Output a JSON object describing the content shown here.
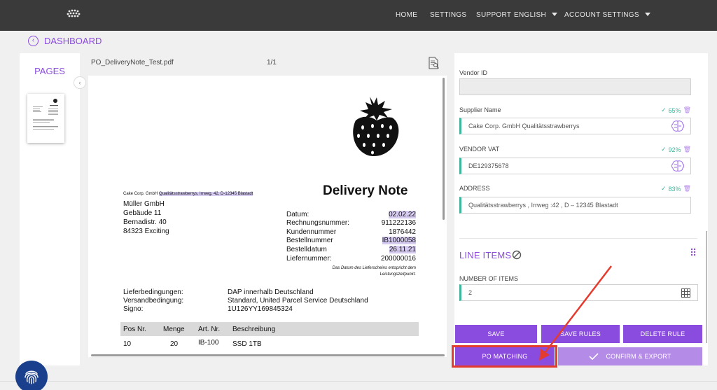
{
  "nav": {
    "home": "HOME",
    "settings": "SETTINGS",
    "support": "SUPPORT",
    "language": "ENGLISH",
    "account": "ACCOUNT SETTINGS"
  },
  "breadcrumb": {
    "label": "DASHBOARD"
  },
  "pages": {
    "title": "PAGES"
  },
  "viewer": {
    "filename": "PO_DeliveryNote_Test.pdf",
    "page_indicator": "1/1"
  },
  "document": {
    "sender_prefix": "Cake Corp. GmbH",
    "sender_rest": "Qualitätsstrawberrys, Irrweg. 42, D-12345 Blastadt",
    "title": "Delivery Note",
    "recipient": [
      "Müller GmbH",
      "Gebäude 11",
      "Bernadistr. 40",
      "84323 Exciting"
    ],
    "meta_labels": [
      "Datum:",
      "Rechnungsnummer:",
      "Kundennummer",
      "Bestellnummer",
      "Bestelldatum",
      "Liefernummer:"
    ],
    "meta_values": [
      "02.02.22",
      "911222136",
      "1876442",
      "IB1000058",
      "26.11.21",
      "200000016"
    ],
    "footnote_line1": "Das Datum des Lieferscheins entspricht dem",
    "footnote_line2": "Leistungszeitpunkt.",
    "terms_labels": [
      "Lieferbedingungen:",
      "Versandbedingung:",
      "Signo:"
    ],
    "terms_values": [
      "DAP innerhalb Deutschland",
      "Standard, United Parcel Service Deutschland",
      "1U126YY169845324"
    ],
    "table_headers": [
      "Pos Nr.",
      "Menge",
      "Art. Nr.",
      "Beschreibung"
    ],
    "table_row": [
      "10",
      "20",
      "IB-100",
      "SSD 1TB"
    ]
  },
  "form": {
    "vendor_id_label": "Vendor ID",
    "vendor_id_value": "",
    "supplier_label": "Supplier Name",
    "supplier_conf": "65%",
    "supplier_value": "Cake Corp. GmbH Qualitätsstrawberrys",
    "vat_label": "VENDOR VAT",
    "vat_conf": "92%",
    "vat_value": "DE129375678",
    "address_label": "ADDRESS",
    "address_conf": "83%",
    "address_value": "Qualitätsstrawberrys , Irrweg  :42 , D – 12345 Blastadt",
    "line_items_title": "LINE ITEMS",
    "num_items_label": "NUMBER OF ITEMS",
    "num_items_value": "2"
  },
  "buttons": {
    "save": "SAVE",
    "save_rules": "SAVE RULES",
    "delete_rule": "DELETE RULE",
    "po_matching": "PO MATCHING",
    "confirm_export": "CONFIRM & EXPORT"
  },
  "colors": {
    "accent": "#8a4bdf",
    "accent_light": "#b58be8",
    "confidence": "#3eb59a",
    "highlight_red": "#e43b2f",
    "topbar": "#3a3a3a"
  }
}
